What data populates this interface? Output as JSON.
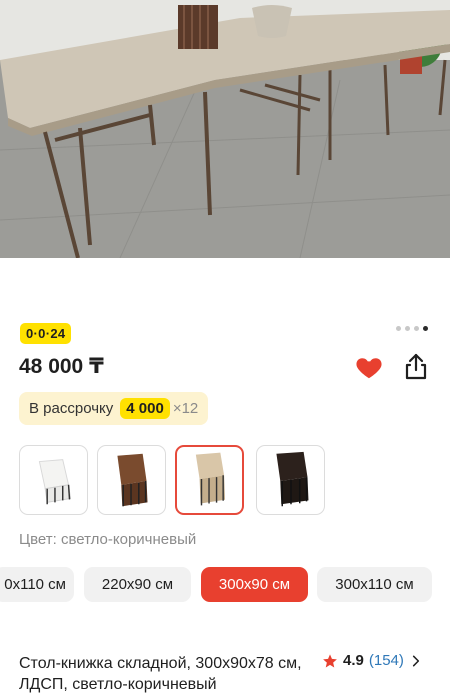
{
  "product": {
    "badge": "0·0·24",
    "price": "48 000 ₸",
    "installment": {
      "label": "В рассрочку",
      "amount": "4 000",
      "multiplier": "×12"
    },
    "color_label": "Цвет: светло-коричневый",
    "colors": [
      {
        "name": "white",
        "selected": false
      },
      {
        "name": "brown-wood",
        "selected": false
      },
      {
        "name": "light-brown",
        "selected": true
      },
      {
        "name": "dark-brown",
        "selected": false
      }
    ],
    "sizes": [
      {
        "label": "0x110 см",
        "selected": false
      },
      {
        "label": "220x90 см",
        "selected": false
      },
      {
        "label": "300x90 см",
        "selected": true
      },
      {
        "label": "300x110 см",
        "selected": false
      }
    ],
    "title": "Стол-книжка складной, 300x90x78 см, ЛДСП, светло-коричневый",
    "rating": {
      "score": "4.9",
      "count": "(154)"
    },
    "gallery": {
      "total": 4,
      "active_index": 3
    },
    "favorite": true
  },
  "icons": [
    "heart-icon",
    "share-icon",
    "star-icon",
    "chevron-right-icon"
  ],
  "colors": {
    "accent": "#e8402f",
    "badge": "#ffe100",
    "installment_bg": "#fdf3d0",
    "link": "#2f78b8"
  }
}
